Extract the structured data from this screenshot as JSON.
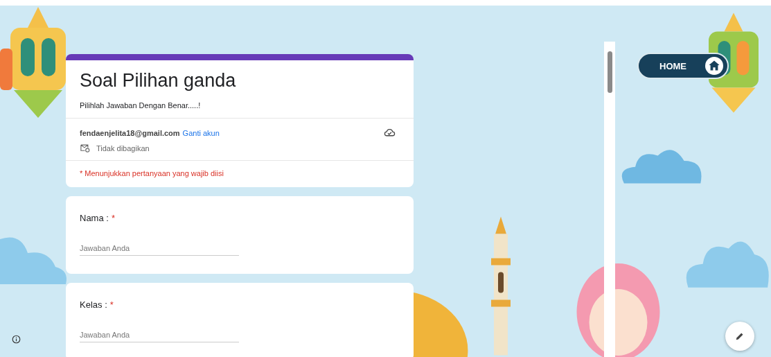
{
  "form": {
    "title": "Soal Pilihan ganda",
    "description": "Pilihlah Jawaban Dengan Benar.....!",
    "account": {
      "email": "fendaenjelita18@gmail.com",
      "switch_link": "Ganti akun",
      "sharing": "Tidak dibagikan"
    },
    "required_note": "* Menunjukkan pertanyaan yang wajib diisi"
  },
  "questions": [
    {
      "label": "Nama :",
      "required": true,
      "required_mark": "*",
      "placeholder": "Jawaban Anda"
    },
    {
      "label": "Kelas :",
      "required": true,
      "required_mark": "*",
      "placeholder": "Jawaban Anda"
    }
  ],
  "home_button": {
    "label": "HOME"
  }
}
